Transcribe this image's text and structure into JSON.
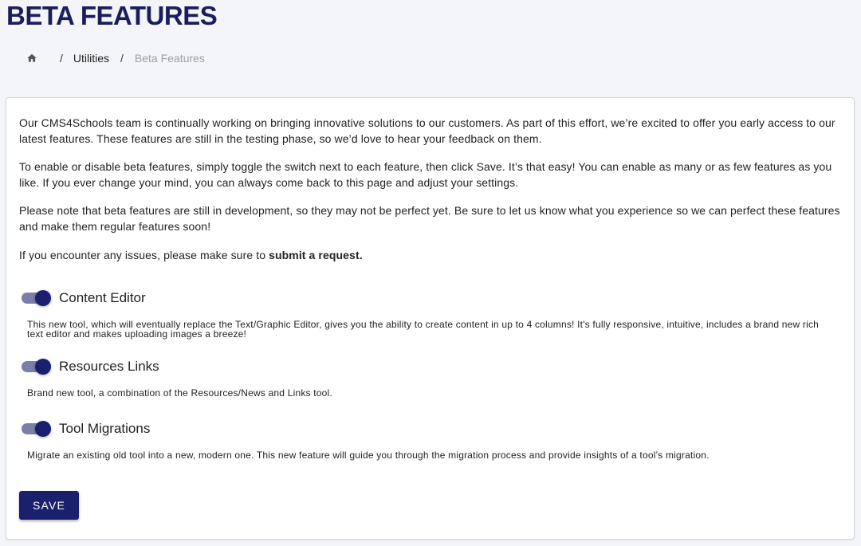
{
  "page": {
    "title": "BETA FEATURES"
  },
  "breadcrumb": {
    "home_icon": "home-icon",
    "separator": "/",
    "items": [
      {
        "label": "Utilities"
      },
      {
        "label": "Beta Features"
      }
    ]
  },
  "intro": {
    "p1": "Our CMS4Schools team is continually working on bringing innovative solutions to our customers. As part of this effort, we’re excited to offer you early access to our latest features. These features are still in the testing phase, so we’d love to hear your feedback on them.",
    "p2": "To enable or disable beta features, simply toggle the switch next to each feature, then click Save. It’s that easy! You can enable as many or as few features as you like. If you ever change your mind, you can always come back to this page and adjust your settings.",
    "p3": "Please note that beta features are still in development, so they may not be perfect yet. Be sure to let us know what you experience so we can perfect these features and make them regular features soon!",
    "p4_prefix": "If you encounter any issues, please make sure to ",
    "p4_link": "submit a request."
  },
  "features": [
    {
      "name": "Content Editor",
      "enabled": true,
      "description": "This new tool, which will eventually replace the Text/Graphic Editor, gives you the ability to create content in up to 4 columns! It's fully responsive, intuitive, includes a brand new rich text editor and makes uploading images a breeze!"
    },
    {
      "name": "Resources Links",
      "enabled": true,
      "description": "Brand new tool, a combination of the Resources/News and Links tool."
    },
    {
      "name": "Tool Migrations",
      "enabled": true,
      "description": "Migrate an existing old tool into a new, modern one. This new feature will guide you through the migration process and provide insights of a tool’s migration."
    }
  ],
  "actions": {
    "save_label": "SAVE"
  },
  "colors": {
    "brand": "#1a1f6e",
    "title": "#1a1f5c",
    "toggle_track": "#7a7ea8",
    "background": "#f3f5f9"
  }
}
